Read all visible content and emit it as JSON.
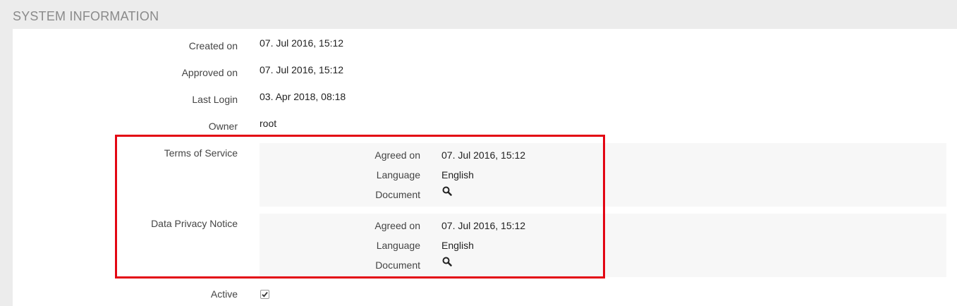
{
  "section": {
    "title": "SYSTEM INFORMATION"
  },
  "fields": {
    "created_on": {
      "label": "Created on",
      "value": "07. Jul 2016, 15:12"
    },
    "approved_on": {
      "label": "Approved on",
      "value": "07. Jul 2016, 15:12"
    },
    "last_login": {
      "label": "Last Login",
      "value": "03. Apr 2018, 08:18"
    },
    "owner": {
      "label": "Owner",
      "value": "root"
    },
    "active": {
      "label": "Active",
      "checked": true
    }
  },
  "agreements": {
    "terms_of_service": {
      "label": "Terms of Service",
      "agreed_on_label": "Agreed on",
      "agreed_on_value": "07. Jul 2016, 15:12",
      "language_label": "Language",
      "language_value": "English",
      "document_label": "Document",
      "document_icon": "search-icon"
    },
    "data_privacy_notice": {
      "label": "Data Privacy Notice",
      "agreed_on_label": "Agreed on",
      "agreed_on_value": "07. Jul 2016, 15:12",
      "language_label": "Language",
      "language_value": "English",
      "document_label": "Document",
      "document_icon": "search-icon"
    }
  },
  "colors": {
    "highlight_border": "#e30613",
    "section_title": "#8a8a8a"
  }
}
